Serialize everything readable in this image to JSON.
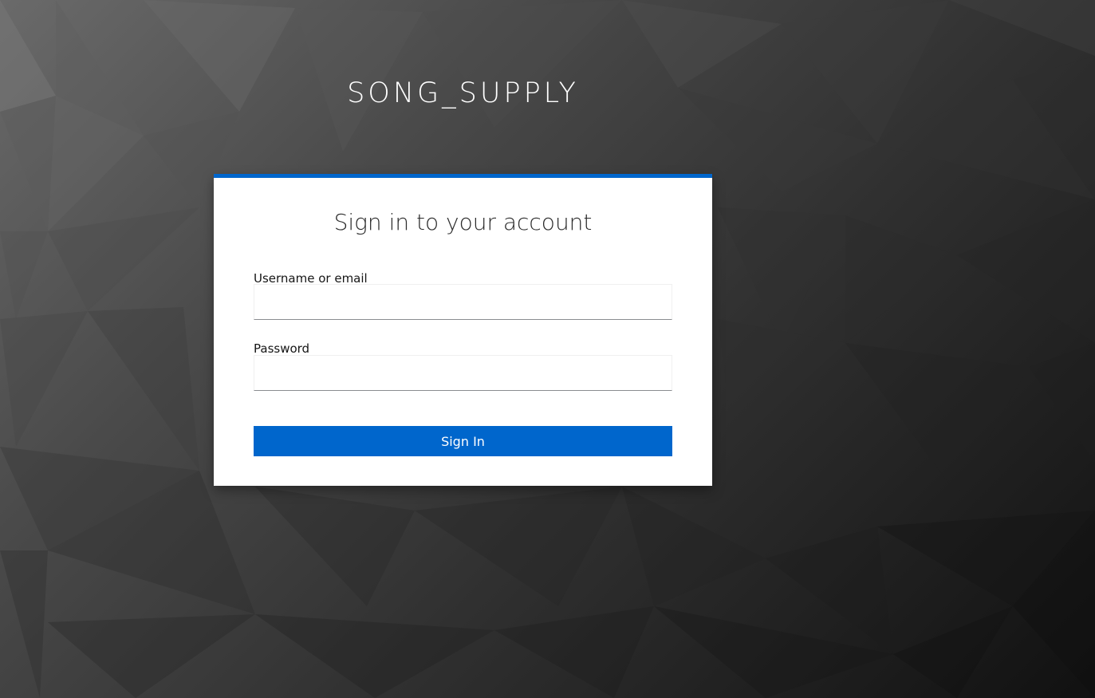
{
  "app": {
    "brand": "SONG_SUPPLY"
  },
  "login": {
    "heading": "Sign in to your account",
    "username_label": "Username or email",
    "username_value": "",
    "password_label": "Password",
    "password_value": "",
    "submit_label": "Sign In"
  },
  "colors": {
    "accent": "#0066cc",
    "card_background": "#ffffff",
    "page_background_dark": "#111111",
    "page_background_light": "#6a6a6a"
  },
  "icons": {
    "background": "low-poly-triangle-pattern"
  }
}
